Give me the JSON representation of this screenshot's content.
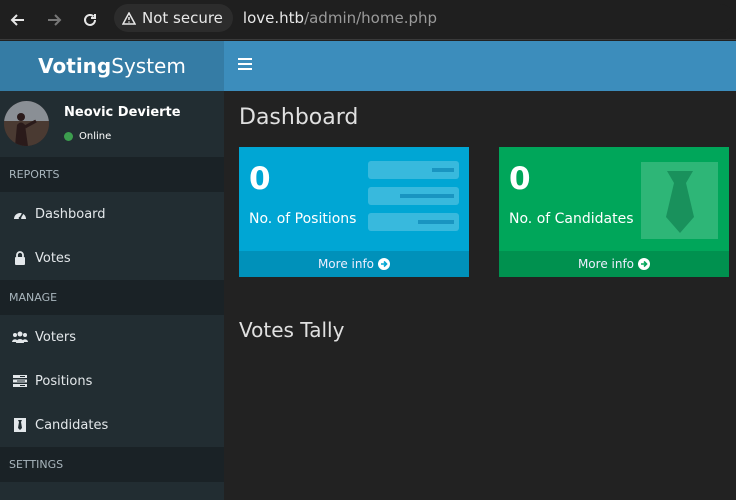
{
  "browser": {
    "security_label": "Not secure",
    "url_host": "love.htb",
    "url_path": "/admin/home.php"
  },
  "app": {
    "logo_bold": "Voting",
    "logo_rest": "System"
  },
  "user": {
    "name": "Neovic Devierte",
    "status": "Online"
  },
  "sidebar": {
    "sections": [
      {
        "header": "REPORTS",
        "items": [
          {
            "label": "Dashboard",
            "icon": "dashboard-icon"
          },
          {
            "label": "Votes",
            "icon": "lock-icon"
          }
        ]
      },
      {
        "header": "MANAGE",
        "items": [
          {
            "label": "Voters",
            "icon": "users-icon"
          },
          {
            "label": "Positions",
            "icon": "list-icon"
          },
          {
            "label": "Candidates",
            "icon": "candidate-icon"
          }
        ]
      },
      {
        "header": "SETTINGS",
        "items": []
      }
    ]
  },
  "main": {
    "title": "Dashboard",
    "boxes": [
      {
        "count": "0",
        "label": "No. of Positions",
        "more": "More info",
        "color": "#00a6d4",
        "icon": "list-icon"
      },
      {
        "count": "0",
        "label": "No. of Candidates",
        "more": "More info",
        "color": "#00a65a",
        "icon": "tie-icon"
      }
    ],
    "section_title": "Votes Tally"
  },
  "colors": {
    "header": "#3c8dbc",
    "logo": "#357ca5",
    "sidebar": "#222d32"
  }
}
